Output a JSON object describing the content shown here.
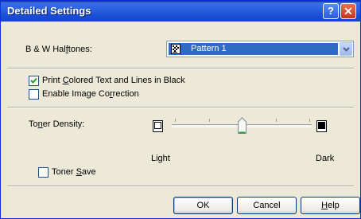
{
  "window": {
    "title": "Detailed Settings",
    "help_glyph": "?",
    "close_glyph": "✕"
  },
  "halftones": {
    "label_pre": "B & W Hal",
    "label_ul": "f",
    "label_post": "tones:",
    "selected": "Pattern 1",
    "icon": "pattern-icon"
  },
  "print_colored": {
    "label_pre": "Print ",
    "label_ul": "C",
    "label_post": "olored Text and Lines in Black",
    "checked": true
  },
  "image_correction": {
    "label_pre": "Enable Image Co",
    "label_ul": "r",
    "label_post": "rection",
    "checked": false
  },
  "toner_density": {
    "label_pre": "To",
    "label_ul": "n",
    "label_post": "er Density:",
    "min_label": "Light",
    "max_label": "Dark",
    "level": 0.5,
    "light_icon": "light-density-icon",
    "dark_icon": "dark-density-icon"
  },
  "toner_save": {
    "label_pre": "Toner ",
    "label_ul": "S",
    "label_post": "ave",
    "checked": false
  },
  "buttons": {
    "ok": "OK",
    "cancel": "Cancel",
    "help_pre": "",
    "help_ul": "H",
    "help_post": "elp"
  }
}
